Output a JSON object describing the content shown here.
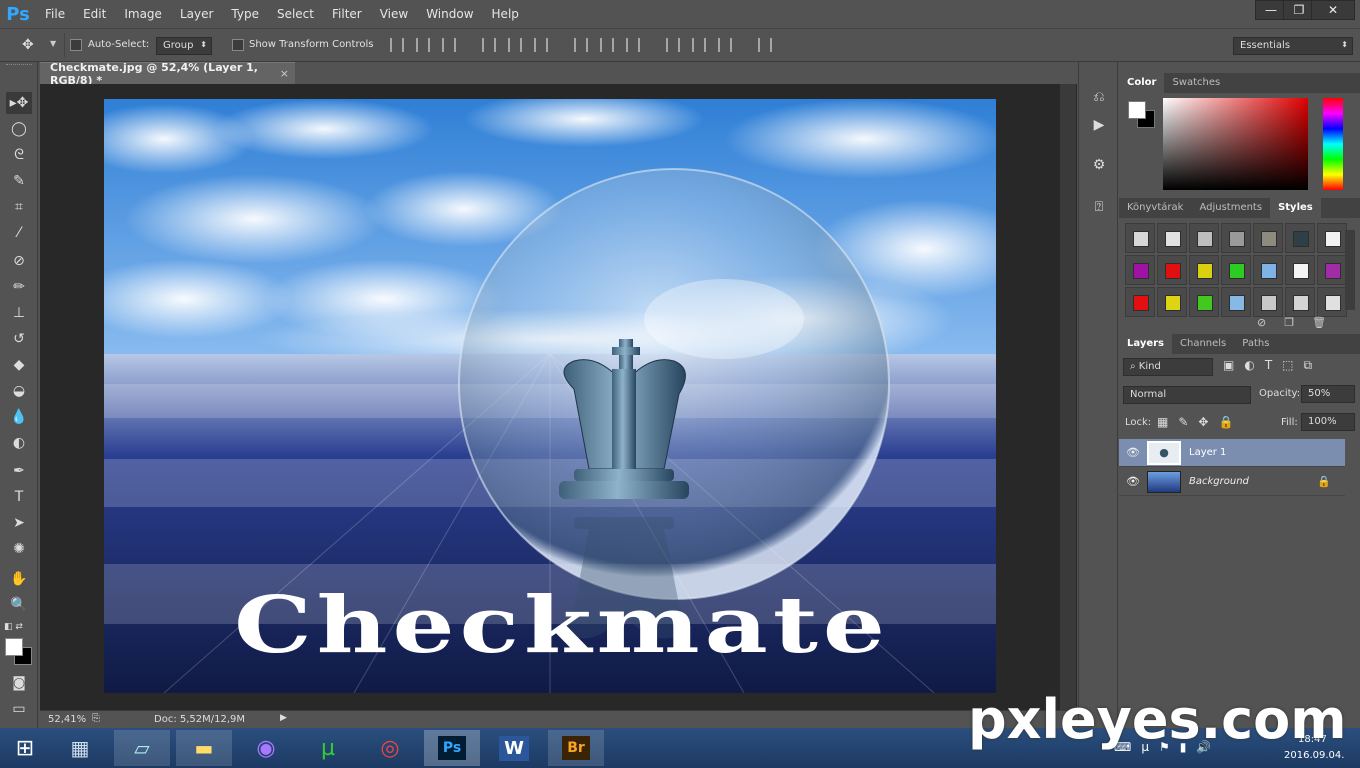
{
  "app": {
    "logo": "Ps"
  },
  "menu": [
    "File",
    "Edit",
    "Image",
    "Layer",
    "Type",
    "Select",
    "Filter",
    "View",
    "Window",
    "Help"
  ],
  "window_controls": {
    "minimize": "—",
    "restore": "❐",
    "close": "✕"
  },
  "options_bar": {
    "auto_select_label": "Auto-Select:",
    "auto_select_value": "Group",
    "show_transform_label": "Show Transform Controls",
    "workspace": "Essentials"
  },
  "document": {
    "tab_title": "Checkmate.jpg @ 52,4% (Layer 1, RGB/8) *",
    "tab_close": "×",
    "canvas_text": "Checkmate"
  },
  "status": {
    "zoom": "52,41%",
    "doc": "Doc: 5,52M/12,9M"
  },
  "panels": {
    "color_tabs": [
      "Color",
      "Swatches"
    ],
    "library_tabs": [
      "Könyvtárak",
      "Adjustments",
      "Styles"
    ],
    "layers_tabs": [
      "Layers",
      "Channels",
      "Paths"
    ],
    "kind_label": "Kind",
    "blend_mode": "Normal",
    "opacity_label": "Opacity:",
    "opacity_value": "50%",
    "lock_label": "Lock:",
    "fill_label": "Fill:",
    "fill_value": "100%",
    "layers": [
      {
        "name": "Layer 1",
        "selected": true
      },
      {
        "name": "Background",
        "selected": false
      }
    ]
  },
  "styles_swatches": [
    [
      "#d8d8d8",
      "#e2e2e2",
      "#bdbdbd",
      "#9a9a9a",
      "#8e8a7e",
      "#2f3f48",
      "#f2f2f2"
    ],
    [
      "#a012a6",
      "#e01010",
      "#d9d012",
      "#2ccc22",
      "#7fb3e6",
      "#f4f4f4",
      "#a12ca6"
    ],
    [
      "#e21010",
      "#dcd414",
      "#42c81e",
      "#86b9e4",
      "#c8c8c8",
      "#d4d4d4",
      "#e0e0e0"
    ]
  ],
  "taskbar": {
    "time": "18:47",
    "date": "2016.09.04."
  },
  "watermark": "pxleyes.com",
  "colors": {
    "accent": "#31a8ff",
    "panel_bg": "#535353",
    "selected_layer": "#7b8eaf"
  }
}
